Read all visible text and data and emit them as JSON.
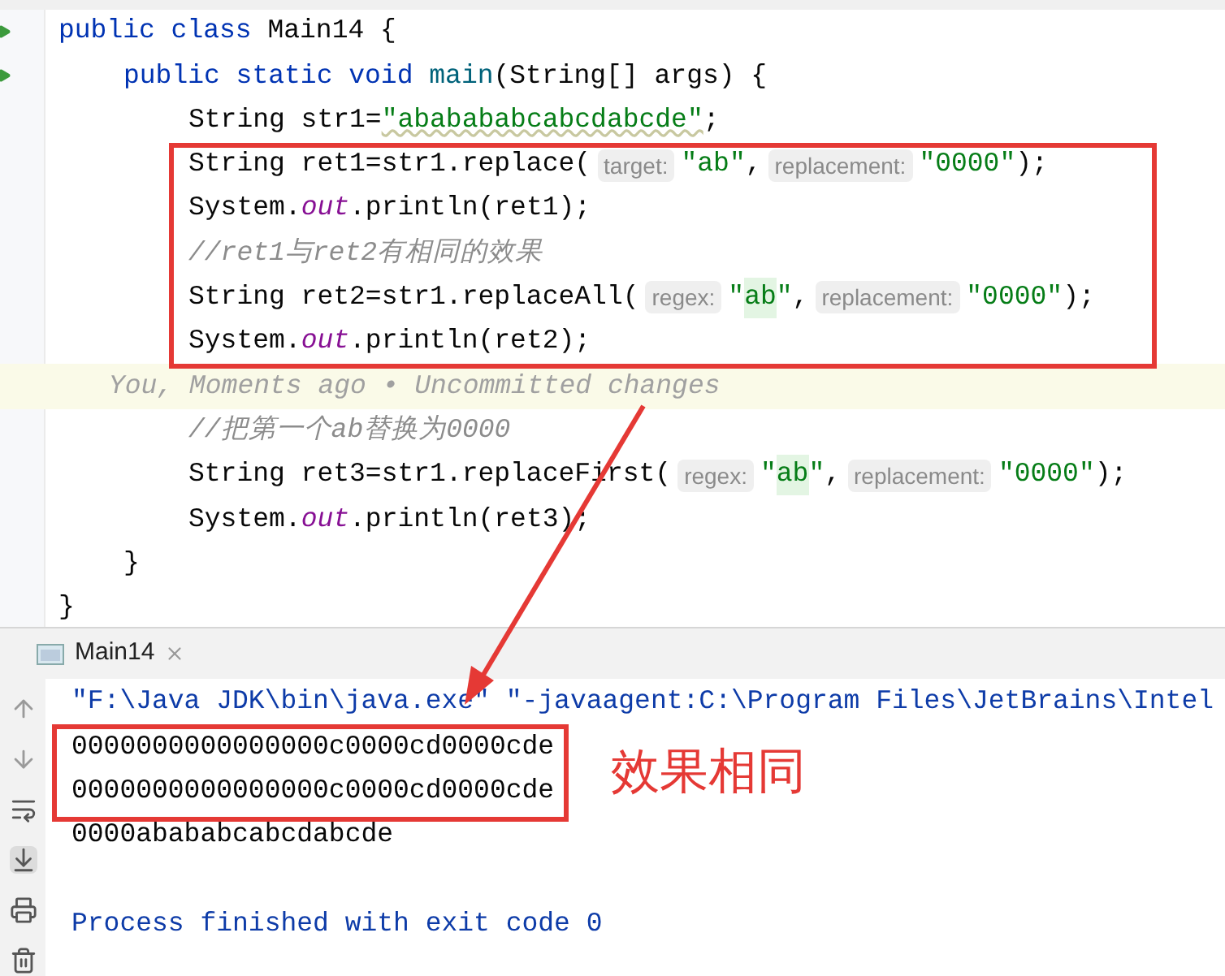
{
  "editor": {
    "lines": [
      {
        "kind": "code",
        "tokens": [
          {
            "text": "public class",
            "kind": "keyword"
          },
          {
            "text": " Main14 {",
            "kind": "plain"
          }
        ],
        "children": [
          {
            "kind": "code",
            "tokens": [
              {
                "text": "public static void",
                "kind": "keyword"
              },
              {
                "text": " main",
                "kind": "method"
              },
              {
                "text": "(String[] args) {",
                "kind": "plain"
              }
            ],
            "children": [
              {
                "kind": "code",
                "tokens": [
                  {
                    "text": "String str1=",
                    "kind": "plain"
                  },
                  {
                    "text": "\"ababababcabcdabcde\"",
                    "kind": "string-typo"
                  },
                  {
                    "text": ";",
                    "kind": "plain"
                  }
                ]
              },
              {
                "kind": "code",
                "tokens": [
                  {
                    "text": "String ret1=str1.replace(",
                    "kind": "plain"
                  },
                  {
                    "text": "target:",
                    "kind": "hint"
                  },
                  {
                    "text": "\"ab\"",
                    "kind": "string"
                  },
                  {
                    "text": ",",
                    "kind": "plain"
                  },
                  {
                    "text": "replacement:",
                    "kind": "hint"
                  },
                  {
                    "text": "\"0000\"",
                    "kind": "string"
                  },
                  {
                    "text": ");",
                    "kind": "plain"
                  }
                ]
              },
              {
                "kind": "code",
                "tokens": [
                  {
                    "text": "System.",
                    "kind": "plain"
                  },
                  {
                    "text": "out",
                    "kind": "field"
                  },
                  {
                    "text": ".println(ret1);",
                    "kind": "plain"
                  }
                ]
              },
              {
                "kind": "code",
                "tokens": [
                  {
                    "text": "//ret1与ret2有相同的效果",
                    "kind": "comment"
                  }
                ]
              },
              {
                "kind": "code",
                "tokens": [
                  {
                    "text": "String ret2=str1.replaceAll(",
                    "kind": "plain"
                  },
                  {
                    "text": "regex:",
                    "kind": "hint"
                  },
                  {
                    "text": "\"",
                    "kind": "string"
                  },
                  {
                    "text": "ab",
                    "kind": "string-match"
                  },
                  {
                    "text": "\"",
                    "kind": "string"
                  },
                  {
                    "text": ",",
                    "kind": "plain"
                  },
                  {
                    "text": "replacement:",
                    "kind": "hint"
                  },
                  {
                    "text": "\"0000\"",
                    "kind": "string"
                  },
                  {
                    "text": ");",
                    "kind": "plain"
                  }
                ]
              },
              {
                "kind": "code",
                "tokens": [
                  {
                    "text": "System.",
                    "kind": "plain"
                  },
                  {
                    "text": "out",
                    "kind": "field"
                  },
                  {
                    "text": ".println(ret2);",
                    "kind": "plain"
                  }
                ]
              },
              {
                "kind": "blame",
                "tokens": [
                  {
                    "text": "You, Moments ago • Uncommitted changes",
                    "kind": "blame"
                  }
                ]
              },
              {
                "kind": "code",
                "tokens": [
                  {
                    "text": "//把第一个ab替换为0000",
                    "kind": "comment"
                  }
                ]
              },
              {
                "kind": "code",
                "tokens": [
                  {
                    "text": "String ret3=str1.replaceFirst(",
                    "kind": "plain"
                  },
                  {
                    "text": "regex:",
                    "kind": "hint"
                  },
                  {
                    "text": "\"",
                    "kind": "string"
                  },
                  {
                    "text": "ab",
                    "kind": "string-match"
                  },
                  {
                    "text": "\"",
                    "kind": "string"
                  },
                  {
                    "text": ",",
                    "kind": "plain"
                  },
                  {
                    "text": "replacement:",
                    "kind": "hint"
                  },
                  {
                    "text": "\"0000\"",
                    "kind": "string"
                  },
                  {
                    "text": ");",
                    "kind": "plain"
                  }
                ]
              },
              {
                "kind": "code",
                "tokens": [
                  {
                    "text": "System.",
                    "kind": "plain"
                  },
                  {
                    "text": "out",
                    "kind": "field"
                  },
                  {
                    "text": ".println(ret3);",
                    "kind": "plain"
                  }
                ]
              }
            ],
            "closing": "}"
          }
        ],
        "closing": "}"
      }
    ]
  },
  "run_panel": {
    "tab": {
      "label": "Main14",
      "selected": true
    },
    "output": [
      {
        "kind": "system",
        "text": "\"F:\\Java JDK\\bin\\java.exe\" \"-javaagent:C:\\Program Files\\JetBrains\\Intel"
      },
      {
        "kind": "output",
        "text": "0000000000000000c0000cd0000cde"
      },
      {
        "kind": "output",
        "text": "0000000000000000c0000cd0000cde"
      },
      {
        "kind": "output",
        "text": "0000abababcabcdabcde"
      },
      {
        "kind": "blank"
      },
      {
        "kind": "system",
        "text": "Process finished with exit code 0"
      }
    ]
  },
  "annotation": {
    "label": "效果相同"
  }
}
